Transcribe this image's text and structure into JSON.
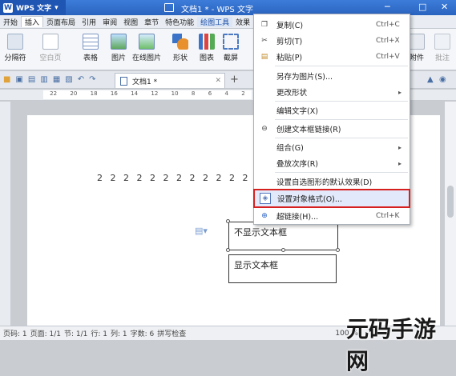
{
  "titlebar": {
    "app": "WPS 文字",
    "window_title": "文档1 * - WPS 文字",
    "icons": [
      "minimize-icon",
      "maximize-icon",
      "close-icon"
    ]
  },
  "menu": [
    "开始",
    "插入",
    "页面布局",
    "引用",
    "审阅",
    "视图",
    "章节",
    "特色功能",
    "绘图工具",
    "效果"
  ],
  "ribbon": {
    "buttons": [
      "分隔符",
      "空白页",
      "表格",
      "图片",
      "在线图片",
      "形状",
      "图表",
      "截屏"
    ],
    "right_buttons": [
      "附件",
      "批注"
    ]
  },
  "doc_tab": {
    "label": "文档1 *",
    "add": "+"
  },
  "ruler": {
    "ticks": [
      "22",
      "20",
      "18",
      "16",
      "14",
      "12",
      "10",
      "8",
      "6",
      "4",
      "2"
    ]
  },
  "document": {
    "text_line": "2 2 2 2 2 2 2 2 2 2 2 2 2 2 2",
    "box1": "不显示文本框",
    "box2": "显示文本框"
  },
  "context_menu": {
    "items": [
      {
        "label": "复制(C)",
        "shortcut": "Ctrl+C",
        "icon": "copy-icon"
      },
      {
        "label": "剪切(T)",
        "shortcut": "Ctrl+X",
        "icon": "scissors-icon"
      },
      {
        "label": "粘贴(P)",
        "shortcut": "Ctrl+V",
        "icon": "paste-icon"
      },
      {
        "label": "另存为图片(S)...",
        "shortcut": "",
        "icon": ""
      },
      {
        "label": "更改形状",
        "shortcut": "",
        "icon": "",
        "submenu": true
      },
      {
        "label": "编辑文字(X)",
        "shortcut": "",
        "icon": ""
      },
      {
        "label": "创建文本框链接(R)",
        "shortcut": "",
        "icon": "link-chain-icon"
      },
      {
        "label": "组合(G)",
        "shortcut": "",
        "icon": "",
        "submenu": true
      },
      {
        "label": "叠放次序(R)",
        "shortcut": "",
        "icon": "",
        "submenu": true
      },
      {
        "label": "设置自选图形的默认效果(D)",
        "shortcut": "",
        "icon": ""
      },
      {
        "label": "设置对象格式(O)...",
        "shortcut": "",
        "icon": "format-object-icon",
        "highlighted": true
      },
      {
        "label": "超链接(H)...",
        "shortcut": "Ctrl+K",
        "icon": "hyperlink-icon"
      }
    ]
  },
  "status_bar": {
    "items": [
      "页码: 1",
      "页面: 1/1",
      "节: 1/1",
      "行: 1",
      "列: 1",
      "字数: 6",
      "拼写检查"
    ],
    "zoom": "100 %"
  },
  "watermark": "元码手游网",
  "colors": {
    "title_bar": "#2a63c0",
    "highlight_border": "#d61f1f",
    "highlight_bg": "#e2e9fa"
  }
}
